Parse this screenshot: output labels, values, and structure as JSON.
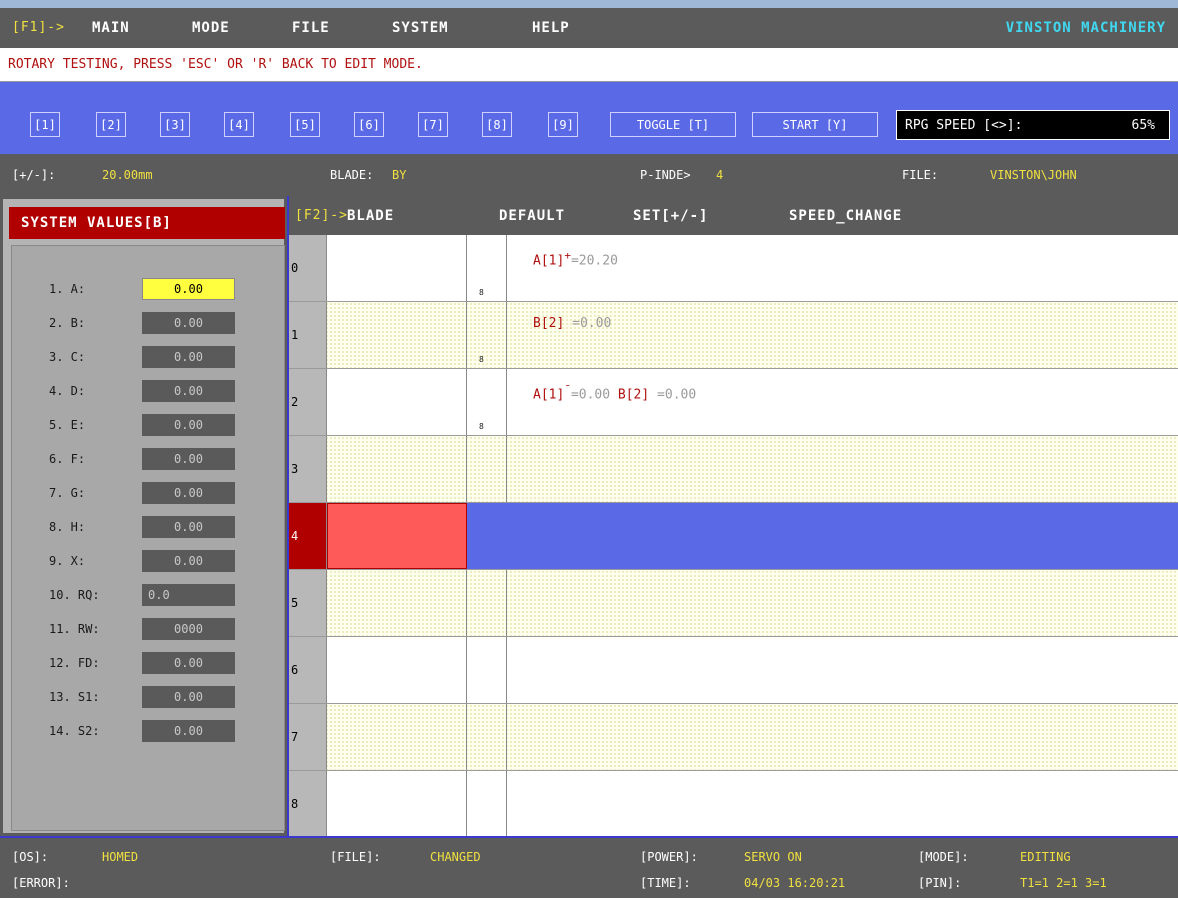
{
  "menu": {
    "f1_label": "[F1]->",
    "items": [
      "MAIN",
      "MODE",
      "FILE",
      "SYSTEM",
      "HELP"
    ],
    "brand": "VINSTON MACHINERY"
  },
  "message": "ROTARY TESTING, PRESS 'ESC' OR 'R' BACK TO EDIT MODE.",
  "keys": [
    "[1]",
    "[2]",
    "[3]",
    "[4]",
    "[5]",
    "[6]",
    "[7]",
    "[8]",
    "[9]",
    "TOGGLE [T]",
    "START [Y]"
  ],
  "rpg": {
    "label": "RPG SPEED [<>]:",
    "value": "65%"
  },
  "info": {
    "step_label": "[+/-]:",
    "step_value": "20.00mm",
    "blade_label": "BLADE:",
    "blade_value": "BY",
    "pindex_label": "P-INDE>",
    "pindex_value": "4",
    "file_label": "FILE:",
    "file_value": "VINSTON\\JOHN"
  },
  "system": {
    "title": "SYSTEM VALUES[B]",
    "rows": [
      {
        "label": "1. A:",
        "value": "0.00"
      },
      {
        "label": "2. B:",
        "value": "0.00"
      },
      {
        "label": "3. C:",
        "value": "0.00"
      },
      {
        "label": "4. D:",
        "value": "0.00"
      },
      {
        "label": "5. E:",
        "value": "0.00"
      },
      {
        "label": "6. F:",
        "value": "0.00"
      },
      {
        "label": "7. G:",
        "value": "0.00"
      },
      {
        "label": "8. H:",
        "value": "0.00"
      },
      {
        "label": "9. X:",
        "value": "0.00"
      },
      {
        "label": "10. RQ:",
        "value": "0.0"
      },
      {
        "label": "11. RW:",
        "value": "0000"
      },
      {
        "label": "12. FD:",
        "value": "0.00"
      },
      {
        "label": "13. S1:",
        "value": "0.00"
      },
      {
        "label": "14. S2:",
        "value": "0.00"
      }
    ]
  },
  "f2": {
    "f2_label": "[F2]->",
    "items": [
      "BLADE",
      "DEFAULT",
      "SET[+/-]",
      "SPEED_CHANGE"
    ]
  },
  "grid": {
    "rows": [
      "0",
      "1",
      "2",
      "3",
      "4",
      "5",
      "6",
      "7",
      "8"
    ],
    "marker": "8",
    "expr0": {
      "name": "A[1]",
      "sup": "+",
      "value": "=20.20"
    },
    "expr1": {
      "name": "B[2]",
      "value": " =0.00"
    },
    "expr2": {
      "name1": "A[1]",
      "sup": "¯",
      "value1": "=0.00",
      "name2": "B[2]",
      "value2": " =0.00"
    }
  },
  "status": {
    "os_label": "[OS]:",
    "os_value": "HOMED",
    "file_label": "[FILE]:",
    "file_value": "CHANGED",
    "power_label": "[POWER]:",
    "power_value": "SERVO ON",
    "mode_label": "[MODE]:",
    "mode_value": "EDITING",
    "error_label": "[ERROR]:",
    "time_label": "[TIME]:",
    "time_value": "04/03 16:20:21",
    "pin_label": "[PIN]:",
    "pin_value": "T1=1 2=1 3=1"
  }
}
